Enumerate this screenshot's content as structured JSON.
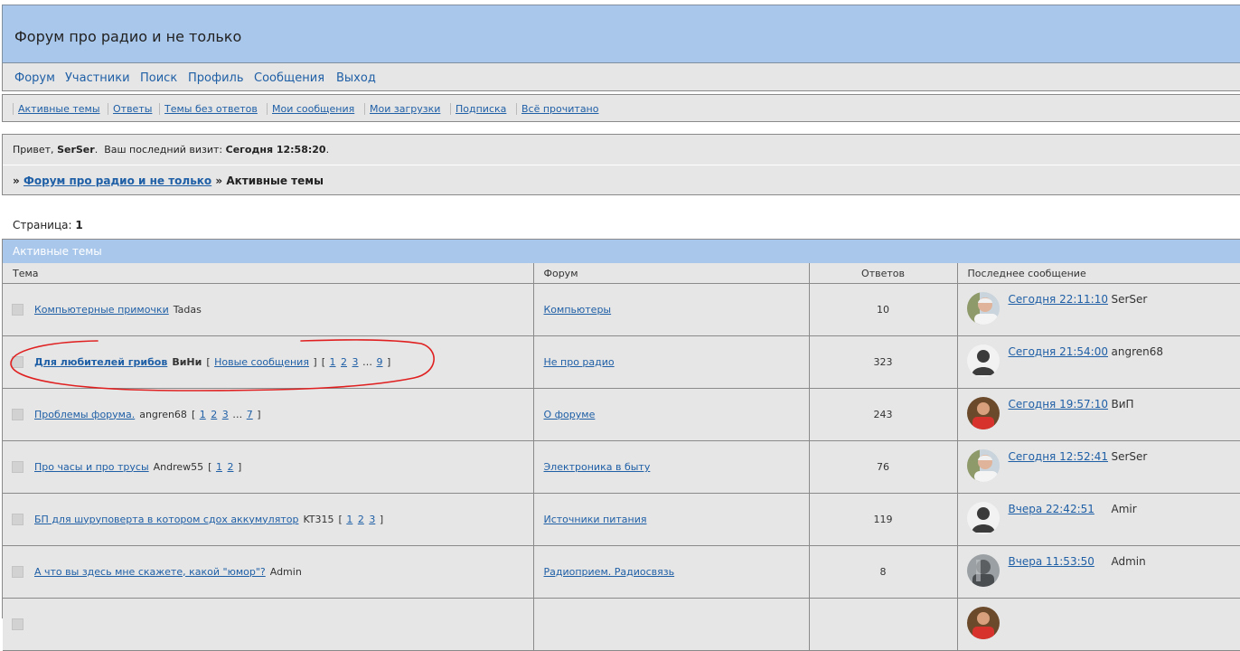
{
  "board": {
    "title": "Форум про радио и не только"
  },
  "nav": {
    "items": [
      {
        "label": "Форум"
      },
      {
        "label": "Участники"
      },
      {
        "label": "Поиск"
      },
      {
        "label": "Профиль"
      },
      {
        "label": "Сообщения"
      },
      {
        "label": "Выход"
      }
    ]
  },
  "subnav": {
    "items": [
      {
        "label": "Активные темы"
      },
      {
        "label": "Ответы"
      },
      {
        "label": "Темы без ответов"
      },
      {
        "label": "Мои сообщения"
      },
      {
        "label": "Мои загрузки"
      },
      {
        "label": "Подписка"
      },
      {
        "label": "Всё прочитано"
      }
    ]
  },
  "welcome": {
    "greeting_prefix": "Привет,",
    "username": "SerSer",
    "visit_label": "Ваш последний визит:",
    "visit_value": "Сегодня 12:58:20",
    "visit_suffix": "."
  },
  "breadcrumb": {
    "prefix": "»",
    "forum_link": "Форум про радио и не только",
    "separator": "»",
    "current": "Активные темы"
  },
  "pagination": {
    "label": "Страница:",
    "current": "1"
  },
  "topics_panel": {
    "title": "Активные темы",
    "columns": {
      "topic": "Тема",
      "forum": "Форум",
      "replies": "Ответов",
      "last_post": "Последнее сообщение"
    },
    "rows": [
      {
        "title": "Компьютерные примочки",
        "author": "Tadas",
        "bold": false,
        "pages": [],
        "forum": "Компьютеры",
        "replies": "10",
        "last_time": "Сегодня 22:11:10",
        "last_user": "SerSer",
        "avatar": "photo-elder"
      },
      {
        "title": "Для любителей грибов",
        "author": "ВиНи",
        "bold": true,
        "new_posts_label": "Новые сообщения",
        "pages": [
          "1",
          "2",
          "3",
          "…",
          "9"
        ],
        "forum": "Не про радио",
        "replies": "323",
        "last_time": "Сегодня 21:54:00",
        "last_user": "angren68",
        "avatar": "default-silhouette"
      },
      {
        "title": "Проблемы форума.",
        "author": "angren68",
        "bold": false,
        "pages": [
          "1",
          "2",
          "3",
          "…",
          "7"
        ],
        "forum": "О форуме",
        "replies": "243",
        "last_time": "Сегодня 19:57:10",
        "last_user": "ВиП",
        "avatar": "photo-red"
      },
      {
        "title": "Про часы и про трусы",
        "author": "Andrew55",
        "bold": false,
        "pages": [
          "1",
          "2"
        ],
        "forum": "Электроника в быту",
        "replies": "76",
        "last_time": "Сегодня 12:52:41",
        "last_user": "SerSer",
        "avatar": "photo-elder"
      },
      {
        "title": "БП для шуруповерта в котором сдох аккумулятор",
        "author": "KT315",
        "bold": false,
        "pages": [
          "1",
          "2",
          "3"
        ],
        "forum": "Источники питания",
        "replies": "119",
        "last_time": "Вчера 22:42:51",
        "last_user": "Amir",
        "avatar": "default-silhouette"
      },
      {
        "title": "А что вы здесь мне скажете, какой \"юмор\"?",
        "author": "Admin",
        "bold": false,
        "pages": [],
        "forum": "Радиоприем. Радиосвязь",
        "replies": "8",
        "last_time": "Вчера 11:53:50",
        "last_user": "Admin",
        "avatar": "photo-grey"
      },
      {
        "title": "",
        "author": "",
        "bold": false,
        "pages": [],
        "forum": "",
        "replies": "",
        "last_time": "",
        "last_user": "",
        "avatar": "photo-red"
      }
    ]
  },
  "colors": {
    "header_bg": "#a9c7eb",
    "panel_bg": "#e6e6e6",
    "link": "#1f5fa6",
    "annotation": "#e02020"
  }
}
